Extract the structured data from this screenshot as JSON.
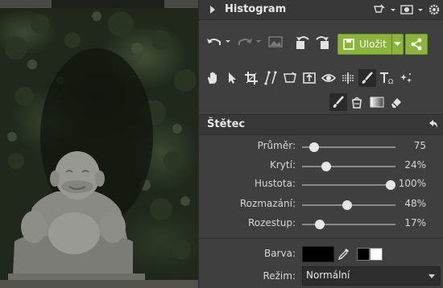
{
  "histogram": {
    "title": "Histogram"
  },
  "toolbar": {
    "save_label": "Uložit"
  },
  "tools": {
    "row1": [
      "hand-icon",
      "pointer-icon",
      "crop-icon",
      "straighten-icon",
      "perspective-icon",
      "frame-icon",
      "eye-icon",
      "gradient-icon",
      "brush-icon",
      "text-icon",
      "stars-icon"
    ],
    "row2": [
      "brush-icon",
      "bucket-icon",
      "gradient-box-icon",
      "eraser-icon"
    ]
  },
  "brush_panel": {
    "title": "Štětec",
    "sliders": [
      {
        "label": "Průměr:",
        "value_text": "75",
        "fraction": 0.13
      },
      {
        "label": "Krytí:",
        "value_text": "24%",
        "fraction": 0.26
      },
      {
        "label": "Hustota:",
        "value_text": "100%",
        "fraction": 0.95
      },
      {
        "label": "Rozmazání:",
        "value_text": "48%",
        "fraction": 0.48
      },
      {
        "label": "Rozestup:",
        "value_text": "17%",
        "fraction": 0.19
      }
    ],
    "color_label": "Barva:",
    "mode_label": "Režim:",
    "mode_value": "Normální"
  },
  "colors": {
    "accent": "#8bb53a"
  }
}
